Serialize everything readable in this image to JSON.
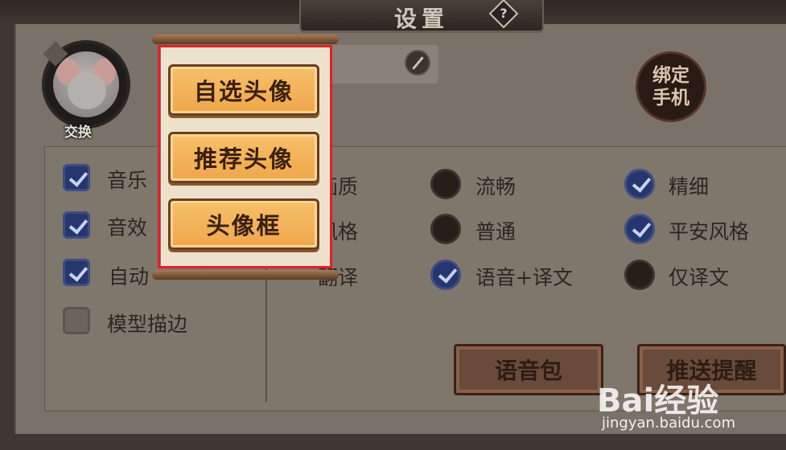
{
  "header": {
    "title": "设置",
    "help_symbol": "?"
  },
  "avatar": {
    "swap_label": "交换"
  },
  "bind_phone": {
    "label": "绑定手机"
  },
  "left_options": [
    {
      "label": "音乐",
      "checked": true
    },
    {
      "label": "音效",
      "checked": true
    },
    {
      "label": "自动",
      "checked": true
    },
    {
      "label": "模型描边",
      "checked": false
    }
  ],
  "right_rows": [
    {
      "label": "画质",
      "options": [
        {
          "label": "流畅",
          "checked": false
        },
        {
          "label": "精细",
          "checked": true
        }
      ]
    },
    {
      "label": "风格",
      "options": [
        {
          "label": "普通",
          "checked": false
        },
        {
          "label": "平安风格",
          "checked": true
        }
      ]
    },
    {
      "label": "翻译",
      "options": [
        {
          "label": "语音+译文",
          "checked": true
        },
        {
          "label": "仅译文",
          "checked": false
        }
      ]
    }
  ],
  "buttons": {
    "voice_pack": "语音包",
    "push_reminder": "推送提醒"
  },
  "popup_menu": {
    "items": [
      "自选头像",
      "推荐头像",
      "头像框"
    ]
  },
  "watermark": {
    "brand": "Bai经验",
    "url": "jingyan.baidu.com"
  },
  "colors": {
    "highlight": "#e0202a",
    "menu_button": "#f0a64a",
    "checkbox_checked": "#26366e"
  }
}
